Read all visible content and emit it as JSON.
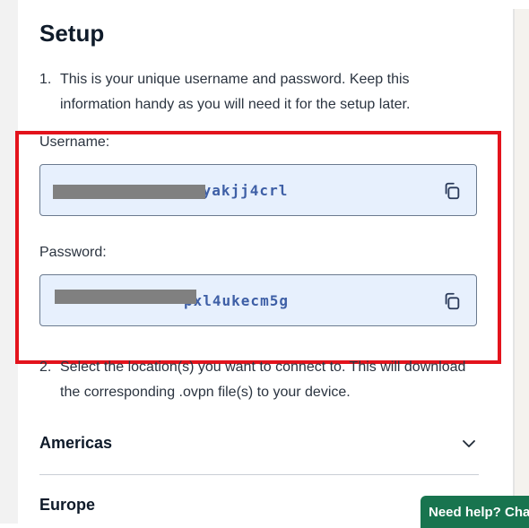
{
  "setup": {
    "title": "Setup",
    "step1_number": "1.",
    "step1_text": "This is your unique username and password. Keep this information handy as you will need it for the setup later.",
    "username_label": "Username:",
    "username_value": "4yakjj4crl",
    "password_label": "Password:",
    "password_value": "pxl4ukecm5g",
    "step2_number": "2.",
    "step2_text": "Select the location(s) you want to connect to. This will download the corresponding .ovpn file(s) to your device."
  },
  "regions": [
    {
      "label": "Americas",
      "icon": "chevron-down-icon"
    },
    {
      "label": "Europe",
      "icon": "chevron-down-icon"
    }
  ],
  "help": {
    "label": "Need help? Chat"
  },
  "colors": {
    "highlight": "#e3131c",
    "field_bg": "#e7f0fd",
    "field_text": "#3e5fa6",
    "help_bg": "#18744f"
  }
}
